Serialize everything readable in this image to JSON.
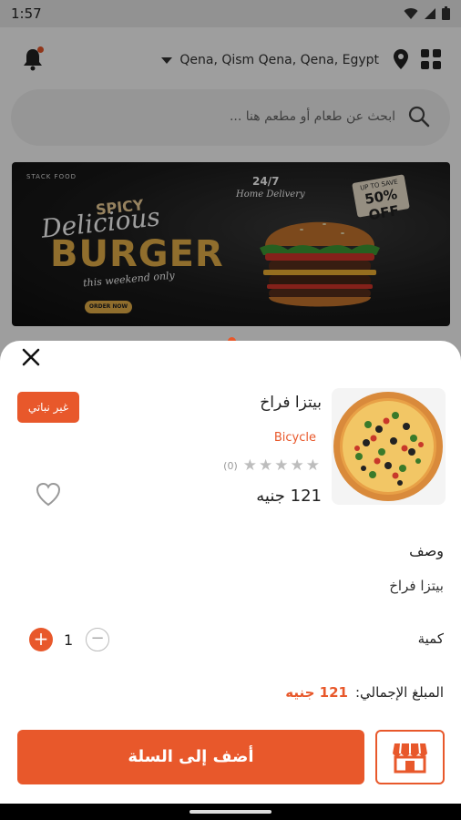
{
  "status_bar": {
    "time": "1:57"
  },
  "header": {
    "location": "Qena, Qism Qena, Qena, Egypt"
  },
  "search": {
    "placeholder": "ابحث عن طعام أو مطعم هنا ..."
  },
  "banner": {
    "brand": "STACK FOOD",
    "line1": "SPICY",
    "line2": "Delicious",
    "line3": "BURGER",
    "line4": "this weekend only",
    "cta": "ORDER NOW",
    "hours": "24/7",
    "home_delivery": "Home Delivery",
    "save_top": "UP TO SAVE",
    "save_value": "50% OFF"
  },
  "product": {
    "badge": "غير نباتي",
    "name": "بيتزا فراخ",
    "restaurant": "Bicycle",
    "rating_count": "(0)",
    "rating": 0,
    "price": "121 جنيه"
  },
  "description": {
    "label": "وصف",
    "text": "بيتزا فراخ"
  },
  "quantity": {
    "label": "كمية",
    "value": "1",
    "plus": "+",
    "minus": "−"
  },
  "total": {
    "label": "المبلغ الإجمالي:",
    "value": "121 جنيه"
  },
  "actions": {
    "add_to_cart": "أضف إلى السلة"
  },
  "icons": {
    "close": "close-icon",
    "heart": "heart-icon",
    "store": "store-icon",
    "bell": "bell-icon",
    "pin": "location-pin-icon",
    "grid": "grid-icon",
    "search": "search-icon"
  },
  "colors": {
    "accent": "#e8582b"
  }
}
